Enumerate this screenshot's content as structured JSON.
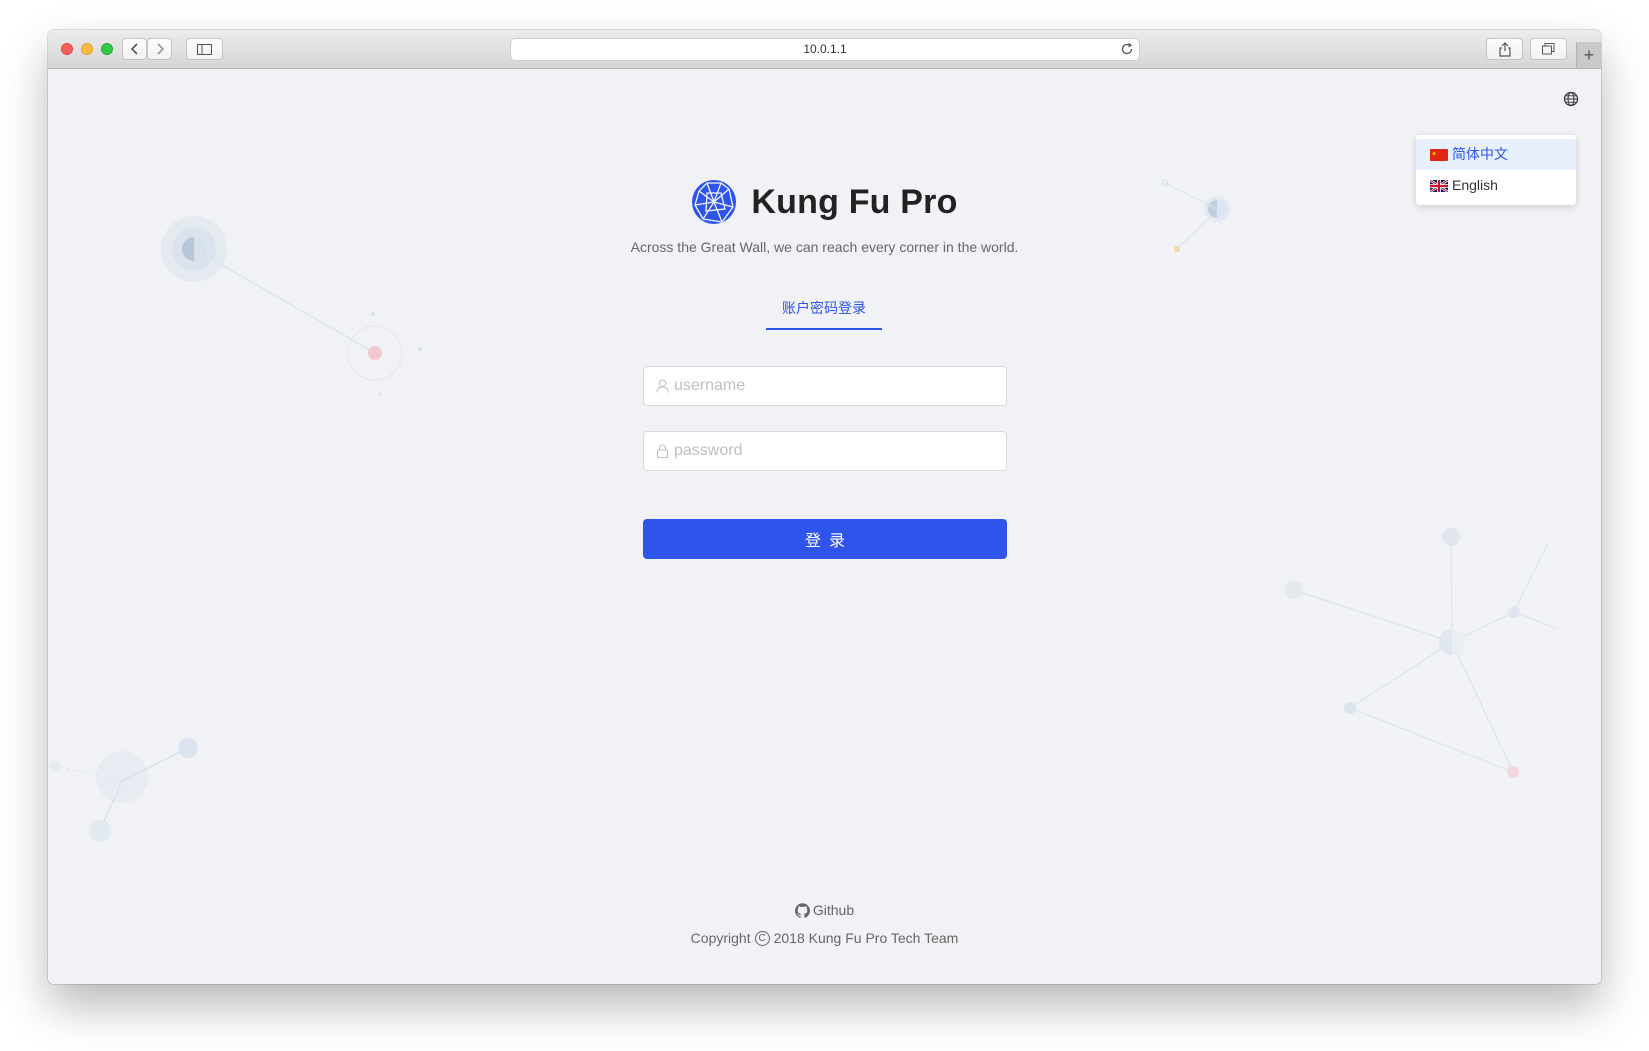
{
  "browser": {
    "url": "10.0.1.1"
  },
  "lang_menu": {
    "items": [
      {
        "label": "简体中文",
        "active": true
      },
      {
        "label": "English",
        "active": false
      }
    ]
  },
  "app": {
    "title": "Kung Fu Pro",
    "slogan": "Across the Great Wall, we can reach every corner in the world."
  },
  "login": {
    "tab_label": "账户密码登录",
    "username_placeholder": "username",
    "password_placeholder": "password",
    "submit_label": "登录"
  },
  "footer": {
    "link_label": "Github",
    "copyright_prefix": "Copyright",
    "copyright_text": "2018 Kung Fu Pro Tech Team"
  },
  "colors": {
    "primary": "#2f54eb",
    "background": "#f0f2f5"
  }
}
